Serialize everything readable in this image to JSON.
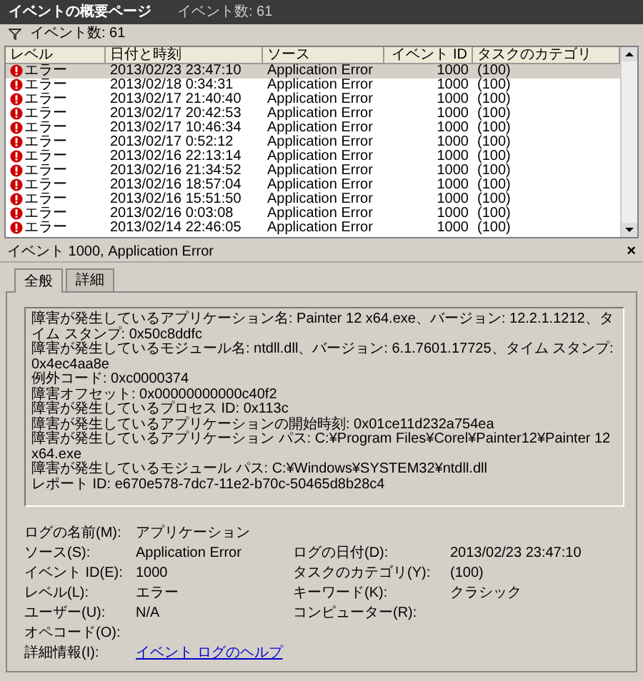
{
  "header": {
    "title": "イベントの概要ページ",
    "count": "イベント数: 61"
  },
  "filter": {
    "label": "イベント数: 61"
  },
  "table": {
    "columns": [
      "レベル",
      "日付と時刻",
      "ソース",
      "イベント ID",
      "タスクのカテゴリ"
    ],
    "rows": [
      {
        "kind": "error",
        "level": "エラー",
        "date": "2013/02/23 23:47:10",
        "source": "Application Error",
        "id": "1000",
        "category": "(100)",
        "selected": true
      },
      {
        "kind": "error",
        "level": "エラー",
        "date": "2013/02/18 0:34:31",
        "source": "Application Error",
        "id": "1000",
        "category": "(100)",
        "selected": false
      },
      {
        "kind": "error",
        "level": "エラー",
        "date": "2013/02/17 21:40:40",
        "source": "Application Error",
        "id": "1000",
        "category": "(100)",
        "selected": false
      },
      {
        "kind": "error",
        "level": "エラー",
        "date": "2013/02/17 20:42:53",
        "source": "Application Error",
        "id": "1000",
        "category": "(100)",
        "selected": false
      },
      {
        "kind": "error",
        "level": "エラー",
        "date": "2013/02/17 10:46:34",
        "source": "Application Error",
        "id": "1000",
        "category": "(100)",
        "selected": false
      },
      {
        "kind": "error",
        "level": "エラー",
        "date": "2013/02/17 0:52:12",
        "source": "Application Error",
        "id": "1000",
        "category": "(100)",
        "selected": false
      },
      {
        "kind": "error",
        "level": "エラー",
        "date": "2013/02/16 22:13:14",
        "source": "Application Error",
        "id": "1000",
        "category": "(100)",
        "selected": false
      },
      {
        "kind": "error",
        "level": "エラー",
        "date": "2013/02/16 21:34:52",
        "source": "Application Error",
        "id": "1000",
        "category": "(100)",
        "selected": false
      },
      {
        "kind": "error",
        "level": "エラー",
        "date": "2013/02/16 18:57:04",
        "source": "Application Error",
        "id": "1000",
        "category": "(100)",
        "selected": false
      },
      {
        "kind": "error",
        "level": "エラー",
        "date": "2013/02/16 15:51:50",
        "source": "Application Error",
        "id": "1000",
        "category": "(100)",
        "selected": false
      },
      {
        "kind": "error",
        "level": "エラー",
        "date": "2013/02/16 0:03:08",
        "source": "Application Error",
        "id": "1000",
        "category": "(100)",
        "selected": false
      },
      {
        "kind": "error",
        "level": "エラー",
        "date": "2013/02/14 22:46:05",
        "source": "Application Error",
        "id": "1000",
        "category": "(100)",
        "selected": false
      }
    ]
  },
  "detail": {
    "title": "イベント 1000, Application Error",
    "close": "×",
    "tabs": [
      {
        "label": "全般",
        "selected": true
      },
      {
        "label": "詳細",
        "selected": false
      }
    ],
    "message": [
      "障害が発生しているアプリケーション名: Painter 12 x64.exe、バージョン: 12.2.1.1212、タイム スタンプ: 0x50c8ddfc",
      "障害が発生しているモジュール名: ntdll.dll、バージョン: 6.1.7601.17725、タイム スタンプ: 0x4ec4aa8e",
      "例外コード: 0xc0000374",
      "障害オフセット: 0x00000000000c40f2",
      "障害が発生しているプロセス ID: 0x113c",
      "障害が発生しているアプリケーションの開始時刻: 0x01ce11d232a754ea",
      "障害が発生しているアプリケーション パス: C:¥Program Files¥Corel¥Painter12¥Painter 12 x64.exe",
      "障害が発生しているモジュール パス: C:¥Windows¥SYSTEM32¥ntdll.dll",
      "レポート ID: e670e578-7dc7-11e2-b70c-50465d8b28c4"
    ],
    "fields": [
      {
        "label": "ログの名前(M):",
        "value": "アプリケーション"
      },
      {
        "label": "ソース(S):",
        "value": "Application Error",
        "label2": "ログの日付(D):",
        "value2": "2013/02/23 23:47:10"
      },
      {
        "label": "イベント ID(E):",
        "value": "1000",
        "label2": "タスクのカテゴリ(Y):",
        "value2": "(100)"
      },
      {
        "label": "レベル(L):",
        "value": "エラー",
        "label2": "キーワード(K):",
        "value2": "クラシック"
      },
      {
        "label": "ユーザー(U):",
        "value": "N/A",
        "label2": "コンピューター(R):"
      },
      {
        "label": "オペコード(O):"
      },
      {
        "label": "詳細情報(I):",
        "link": "イベント ログのヘルプ"
      }
    ]
  }
}
